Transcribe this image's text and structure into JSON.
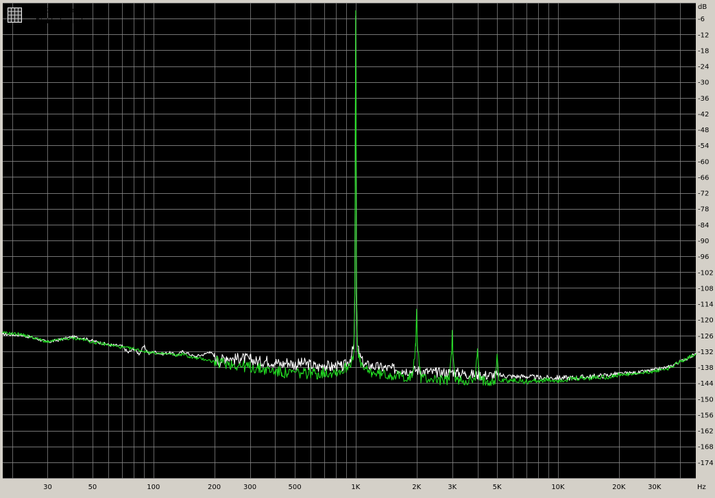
{
  "colors": {
    "background": "#000000",
    "grid": "#8a8a8a",
    "frame": "#d4d0c8",
    "left_channel": "#ffffff",
    "right_channel": "#22dd22"
  },
  "legend": {
    "icon": "grid-icon",
    "items": [
      {
        "label": "Left channel",
        "color": "#ffffff"
      },
      {
        "label": "Right channel",
        "color": "#22dd22"
      }
    ]
  },
  "chart_data": {
    "type": "line",
    "title": "",
    "xlabel": "",
    "ylabel": "",
    "x_unit": "Hz",
    "y_unit": "dB",
    "x_scale": "log",
    "xlim": [
      18,
      48000
    ],
    "ylim": [
      -180,
      0
    ],
    "grid": true,
    "legend_position": "top-left",
    "x_ticks": [
      {
        "v": 30,
        "label": "30"
      },
      {
        "v": 50,
        "label": "50"
      },
      {
        "v": 100,
        "label": "100"
      },
      {
        "v": 200,
        "label": "200"
      },
      {
        "v": 300,
        "label": "300"
      },
      {
        "v": 500,
        "label": "500"
      },
      {
        "v": 1000,
        "label": "1K"
      },
      {
        "v": 2000,
        "label": "2K"
      },
      {
        "v": 3000,
        "label": "3K"
      },
      {
        "v": 5000,
        "label": "5K"
      },
      {
        "v": 10000,
        "label": "10K"
      },
      {
        "v": 20000,
        "label": "20K"
      },
      {
        "v": 30000,
        "label": "30K"
      }
    ],
    "y_ticks": [
      -6,
      -12,
      -18,
      -24,
      -30,
      -36,
      -42,
      -48,
      -54,
      -60,
      -66,
      -72,
      -78,
      -84,
      -90,
      -96,
      -102,
      -108,
      -114,
      -120,
      -126,
      -132,
      -138,
      -144,
      -150,
      -156,
      -162,
      -168,
      -174
    ],
    "series": [
      {
        "name": "Left channel",
        "color": "#ffffff",
        "points": [
          [
            18,
            -125.5
          ],
          [
            22,
            -125.8
          ],
          [
            26,
            -127
          ],
          [
            30,
            -128.5
          ],
          [
            35,
            -127.5
          ],
          [
            40,
            -126.5
          ],
          [
            45,
            -127
          ],
          [
            50,
            -128
          ],
          [
            60,
            -129.5
          ],
          [
            70,
            -130
          ],
          [
            75,
            -132.5
          ],
          [
            80,
            -131
          ],
          [
            85,
            -133
          ],
          [
            90,
            -130
          ],
          [
            95,
            -133
          ],
          [
            100,
            -132
          ],
          [
            110,
            -133
          ],
          [
            120,
            -132.5
          ],
          [
            130,
            -133.5
          ],
          [
            140,
            -132
          ],
          [
            150,
            -133
          ],
          [
            160,
            -134
          ],
          [
            180,
            -133
          ],
          [
            190,
            -132
          ],
          [
            200,
            -134
          ],
          [
            210,
            -136
          ],
          [
            230,
            -134
          ],
          [
            250,
            -135
          ],
          [
            270,
            -134.5
          ],
          [
            300,
            -135
          ],
          [
            330,
            -136
          ],
          [
            360,
            -135.5
          ],
          [
            400,
            -136
          ],
          [
            430,
            -137
          ],
          [
            460,
            -136
          ],
          [
            500,
            -137
          ],
          [
            550,
            -136.5
          ],
          [
            600,
            -137
          ],
          [
            650,
            -138
          ],
          [
            700,
            -137
          ],
          [
            750,
            -138
          ],
          [
            800,
            -137.5
          ],
          [
            850,
            -138
          ],
          [
            900,
            -137
          ],
          [
            950,
            -134
          ],
          [
            980,
            -130
          ],
          [
            990,
            -110
          ],
          [
            1000,
            -5
          ],
          [
            1010,
            -110
          ],
          [
            1020,
            -130
          ],
          [
            1050,
            -134
          ],
          [
            1100,
            -137
          ],
          [
            1200,
            -137.5
          ],
          [
            1300,
            -138
          ],
          [
            1500,
            -138.5
          ],
          [
            1700,
            -139
          ],
          [
            1900,
            -139.5
          ],
          [
            2000,
            -139
          ],
          [
            2100,
            -139.5
          ],
          [
            2500,
            -140
          ],
          [
            2900,
            -140
          ],
          [
            3000,
            -139.5
          ],
          [
            3100,
            -140
          ],
          [
            3500,
            -140.5
          ],
          [
            4000,
            -141
          ],
          [
            5000,
            -141
          ],
          [
            6000,
            -141.5
          ],
          [
            7000,
            -141.5
          ],
          [
            8000,
            -142
          ],
          [
            10000,
            -142
          ],
          [
            12000,
            -142
          ],
          [
            15000,
            -141.5
          ],
          [
            18000,
            -141
          ],
          [
            20000,
            -140.5
          ],
          [
            25000,
            -140
          ],
          [
            30000,
            -139
          ],
          [
            35000,
            -138
          ],
          [
            40000,
            -136
          ],
          [
            45000,
            -134
          ],
          [
            48000,
            -133
          ]
        ]
      },
      {
        "name": "Right channel",
        "color": "#22dd22",
        "points": [
          [
            18,
            -125
          ],
          [
            22,
            -125.5
          ],
          [
            26,
            -127
          ],
          [
            30,
            -128.5
          ],
          [
            35,
            -127.5
          ],
          [
            40,
            -127
          ],
          [
            45,
            -127.5
          ],
          [
            50,
            -128.5
          ],
          [
            60,
            -129.5
          ],
          [
            70,
            -130.5
          ],
          [
            80,
            -131
          ],
          [
            90,
            -132
          ],
          [
            100,
            -132.5
          ],
          [
            110,
            -133
          ],
          [
            120,
            -133
          ],
          [
            130,
            -133.5
          ],
          [
            140,
            -133
          ],
          [
            150,
            -134
          ],
          [
            160,
            -134.5
          ],
          [
            180,
            -135
          ],
          [
            200,
            -136
          ],
          [
            230,
            -136.5
          ],
          [
            250,
            -137
          ],
          [
            300,
            -138
          ],
          [
            330,
            -138.5
          ],
          [
            360,
            -139
          ],
          [
            400,
            -139.5
          ],
          [
            430,
            -140
          ],
          [
            460,
            -140.5
          ],
          [
            500,
            -140
          ],
          [
            550,
            -140.5
          ],
          [
            600,
            -140
          ],
          [
            650,
            -140.5
          ],
          [
            700,
            -140
          ],
          [
            750,
            -140
          ],
          [
            800,
            -139.5
          ],
          [
            850,
            -139.5
          ],
          [
            900,
            -138
          ],
          [
            950,
            -136
          ],
          [
            980,
            -132
          ],
          [
            990,
            -110
          ],
          [
            1000,
            -3
          ],
          [
            1010,
            -110
          ],
          [
            1020,
            -132
          ],
          [
            1050,
            -136
          ],
          [
            1100,
            -139
          ],
          [
            1200,
            -140
          ],
          [
            1300,
            -140.5
          ],
          [
            1500,
            -141
          ],
          [
            1700,
            -141.5
          ],
          [
            1900,
            -142
          ],
          [
            1980,
            -130
          ],
          [
            2000,
            -116
          ],
          [
            2020,
            -130
          ],
          [
            2100,
            -142
          ],
          [
            2300,
            -142.5
          ],
          [
            2500,
            -142.5
          ],
          [
            2700,
            -143
          ],
          [
            2900,
            -143
          ],
          [
            2980,
            -132
          ],
          [
            3000,
            -124
          ],
          [
            3020,
            -132
          ],
          [
            3100,
            -143
          ],
          [
            3500,
            -143
          ],
          [
            3900,
            -143
          ],
          [
            4000,
            -131
          ],
          [
            4100,
            -143
          ],
          [
            4500,
            -143
          ],
          [
            4900,
            -143
          ],
          [
            5000,
            -133
          ],
          [
            5100,
            -143
          ],
          [
            6000,
            -143
          ],
          [
            7000,
            -143.5
          ],
          [
            8000,
            -143
          ],
          [
            10000,
            -143
          ],
          [
            12000,
            -142.5
          ],
          [
            15000,
            -142
          ],
          [
            18000,
            -141.5
          ],
          [
            20000,
            -141
          ],
          [
            25000,
            -140.5
          ],
          [
            30000,
            -139.5
          ],
          [
            35000,
            -138.5
          ],
          [
            40000,
            -136
          ],
          [
            45000,
            -134
          ],
          [
            48000,
            -133
          ]
        ]
      }
    ]
  }
}
